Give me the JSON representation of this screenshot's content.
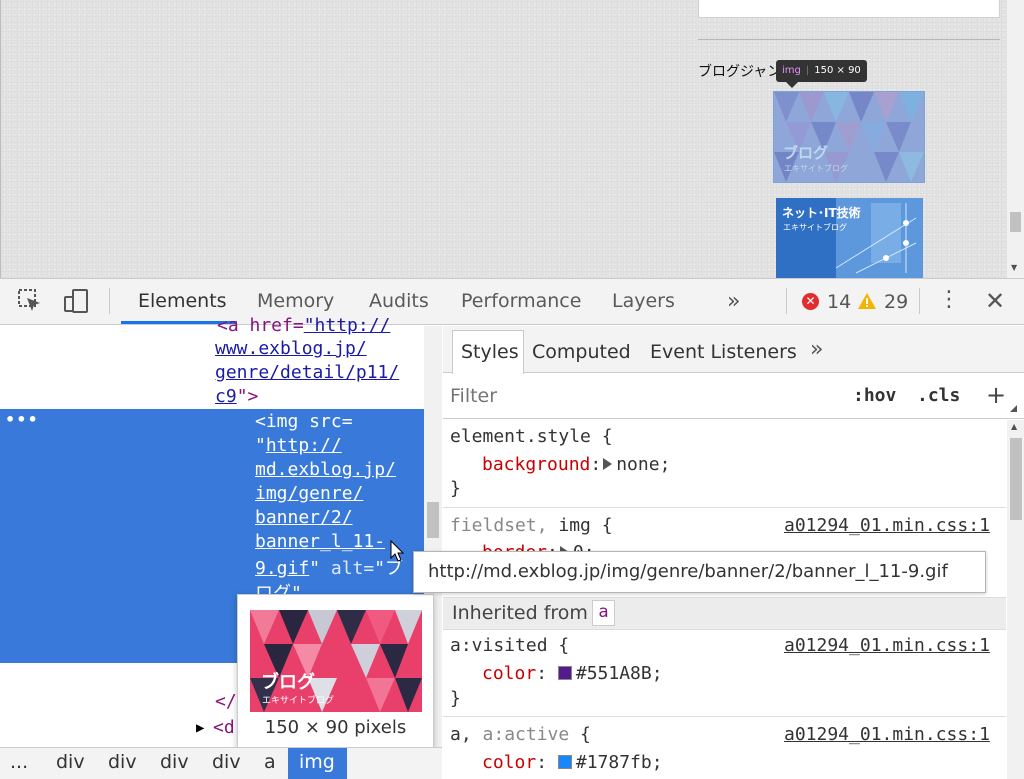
{
  "page": {
    "heading": "ブログジャンル",
    "banner1": {
      "title": "ブログ",
      "subtitle": "エキサイトブログ"
    },
    "banner2": {
      "title": "ネット･IT技術",
      "subtitle": "エキサイトブログ"
    },
    "inspect_tooltip": {
      "tag": "img",
      "size": "150 × 90"
    }
  },
  "devtools": {
    "tabs": [
      "Elements",
      "Memory",
      "Audits",
      "Performance",
      "Layers"
    ],
    "more": "»",
    "errors": "14",
    "warnings": "29",
    "close": "✕",
    "menu": "⋮"
  },
  "elements": {
    "lines": {
      "l0": "www.exblog.jp/",
      "l1": "genre/detail/p11/",
      "l2": "c9",
      "l2b": "\">",
      "img_open": "<img src=",
      "q": "\"",
      "u1": "http://",
      "u2": "md.exblog.jp/",
      "u3": "img/genre/",
      "u4": "banner/2/",
      "u5": "banner_l_11-",
      "u6": "9.gif",
      "alt_q": "\"",
      "alt": " alt=",
      "alt_val": "\"ブ",
      "alt2": "ログ\"...",
      "top_partial": "<a href=",
      "top_partial_val": "\"http://",
      "close_a": "</",
      "next_div": "<d",
      "next_div_arrow": "▶"
    },
    "dots": "•••",
    "preview_caption": "150 × 90 pixels"
  },
  "breadcrumb": [
    "...",
    "div",
    "div",
    "div",
    "div",
    "a",
    "img"
  ],
  "styles": {
    "tabs": [
      "Styles",
      "Computed",
      "Event Listeners"
    ],
    "more": "»",
    "filter_placeholder": "Filter",
    "hov": ":hov",
    "cls": ".cls",
    "plus": "+",
    "element_style": {
      "selector": "element.style {",
      "prop": "background",
      "value": "none;",
      "close": "}"
    },
    "fieldset_rule": {
      "selector_a": "fieldset, ",
      "selector_b": "img {",
      "source": "a01294_01.min.css:1",
      "prop_partial": "border",
      "value_partial": "0;"
    },
    "url_tooltip": "http://md.exblog.jp/img/genre/banner/2/banner_l_11-9.gif",
    "inherited_label": "Inherited from",
    "inherited_tag": "a",
    "visited_rule": {
      "selector": "a:visited {",
      "source": "a01294_01.min.css:1",
      "prop": "color",
      "value": "#551A8B;",
      "swatch": "#551A8B",
      "close": "}"
    },
    "active_rule": {
      "selector_a": "a, ",
      "selector_b": "a:active",
      "selector_c": " {",
      "source": "a01294_01.min.css:1",
      "prop": "color",
      "value": "#1787fb;",
      "swatch": "#1787fb"
    }
  },
  "colors": {
    "selection": "#3879d9",
    "accent": "#1a73e8",
    "error": "#e02d2d",
    "warning": "#f4b400"
  }
}
